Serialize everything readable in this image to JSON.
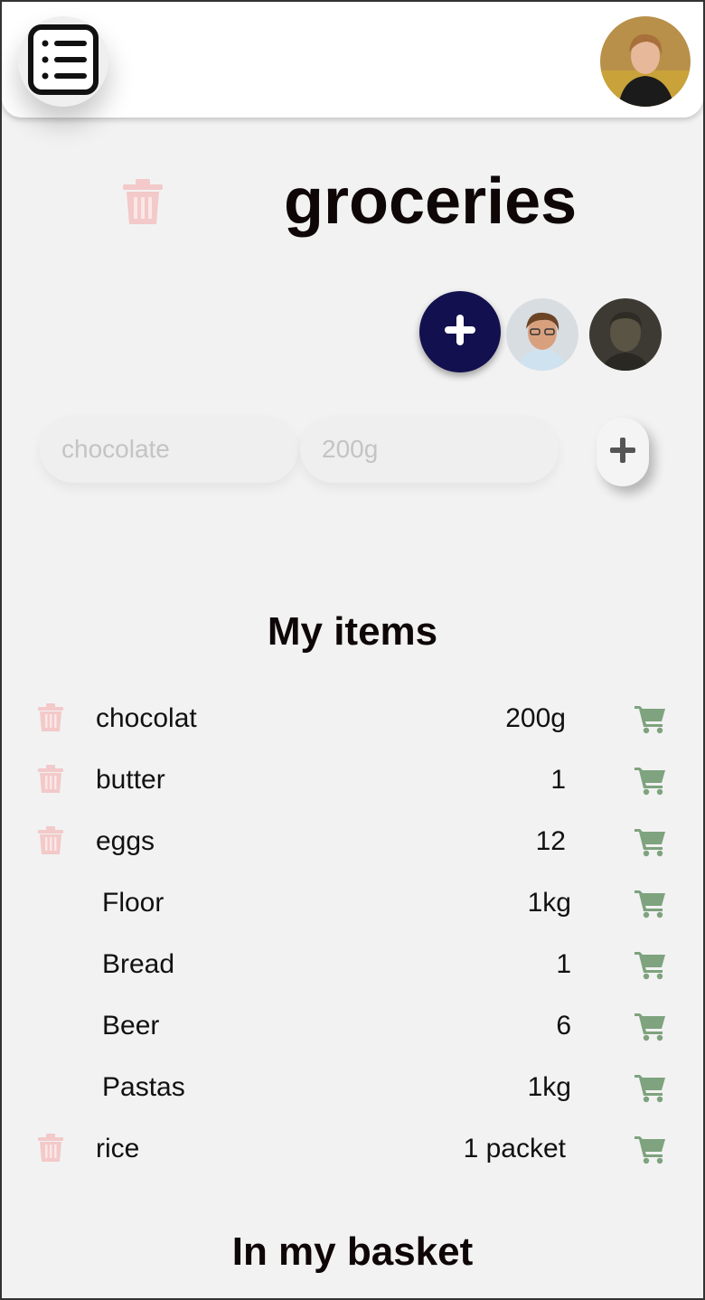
{
  "list": {
    "title": "groceries"
  },
  "form": {
    "name_placeholder": "chocolate",
    "qty_placeholder": "200g"
  },
  "sections": {
    "my_items": "My items",
    "in_basket": "In my basket"
  },
  "items": [
    {
      "name": "chocolat",
      "qty": "200g",
      "deletable": true
    },
    {
      "name": "butter",
      "qty": "1",
      "deletable": true
    },
    {
      "name": "eggs",
      "qty": "12",
      "deletable": true
    },
    {
      "name": "Floor",
      "qty": "1kg",
      "deletable": false
    },
    {
      "name": "Bread",
      "qty": "1",
      "deletable": false
    },
    {
      "name": "Beer",
      "qty": "6",
      "deletable": false
    },
    {
      "name": "Pastas",
      "qty": "1kg",
      "deletable": false
    },
    {
      "name": "rice",
      "qty": "1 packet",
      "deletable": true
    }
  ],
  "icons": {
    "menu": "list-menu-icon",
    "delete": "trash-icon",
    "add": "plus-icon",
    "cart": "cart-icon"
  },
  "colors": {
    "add_member_button": "#13104f",
    "trash": "#f3c9c9",
    "cart": "#7ea37e",
    "background": "#f2f2f2"
  }
}
